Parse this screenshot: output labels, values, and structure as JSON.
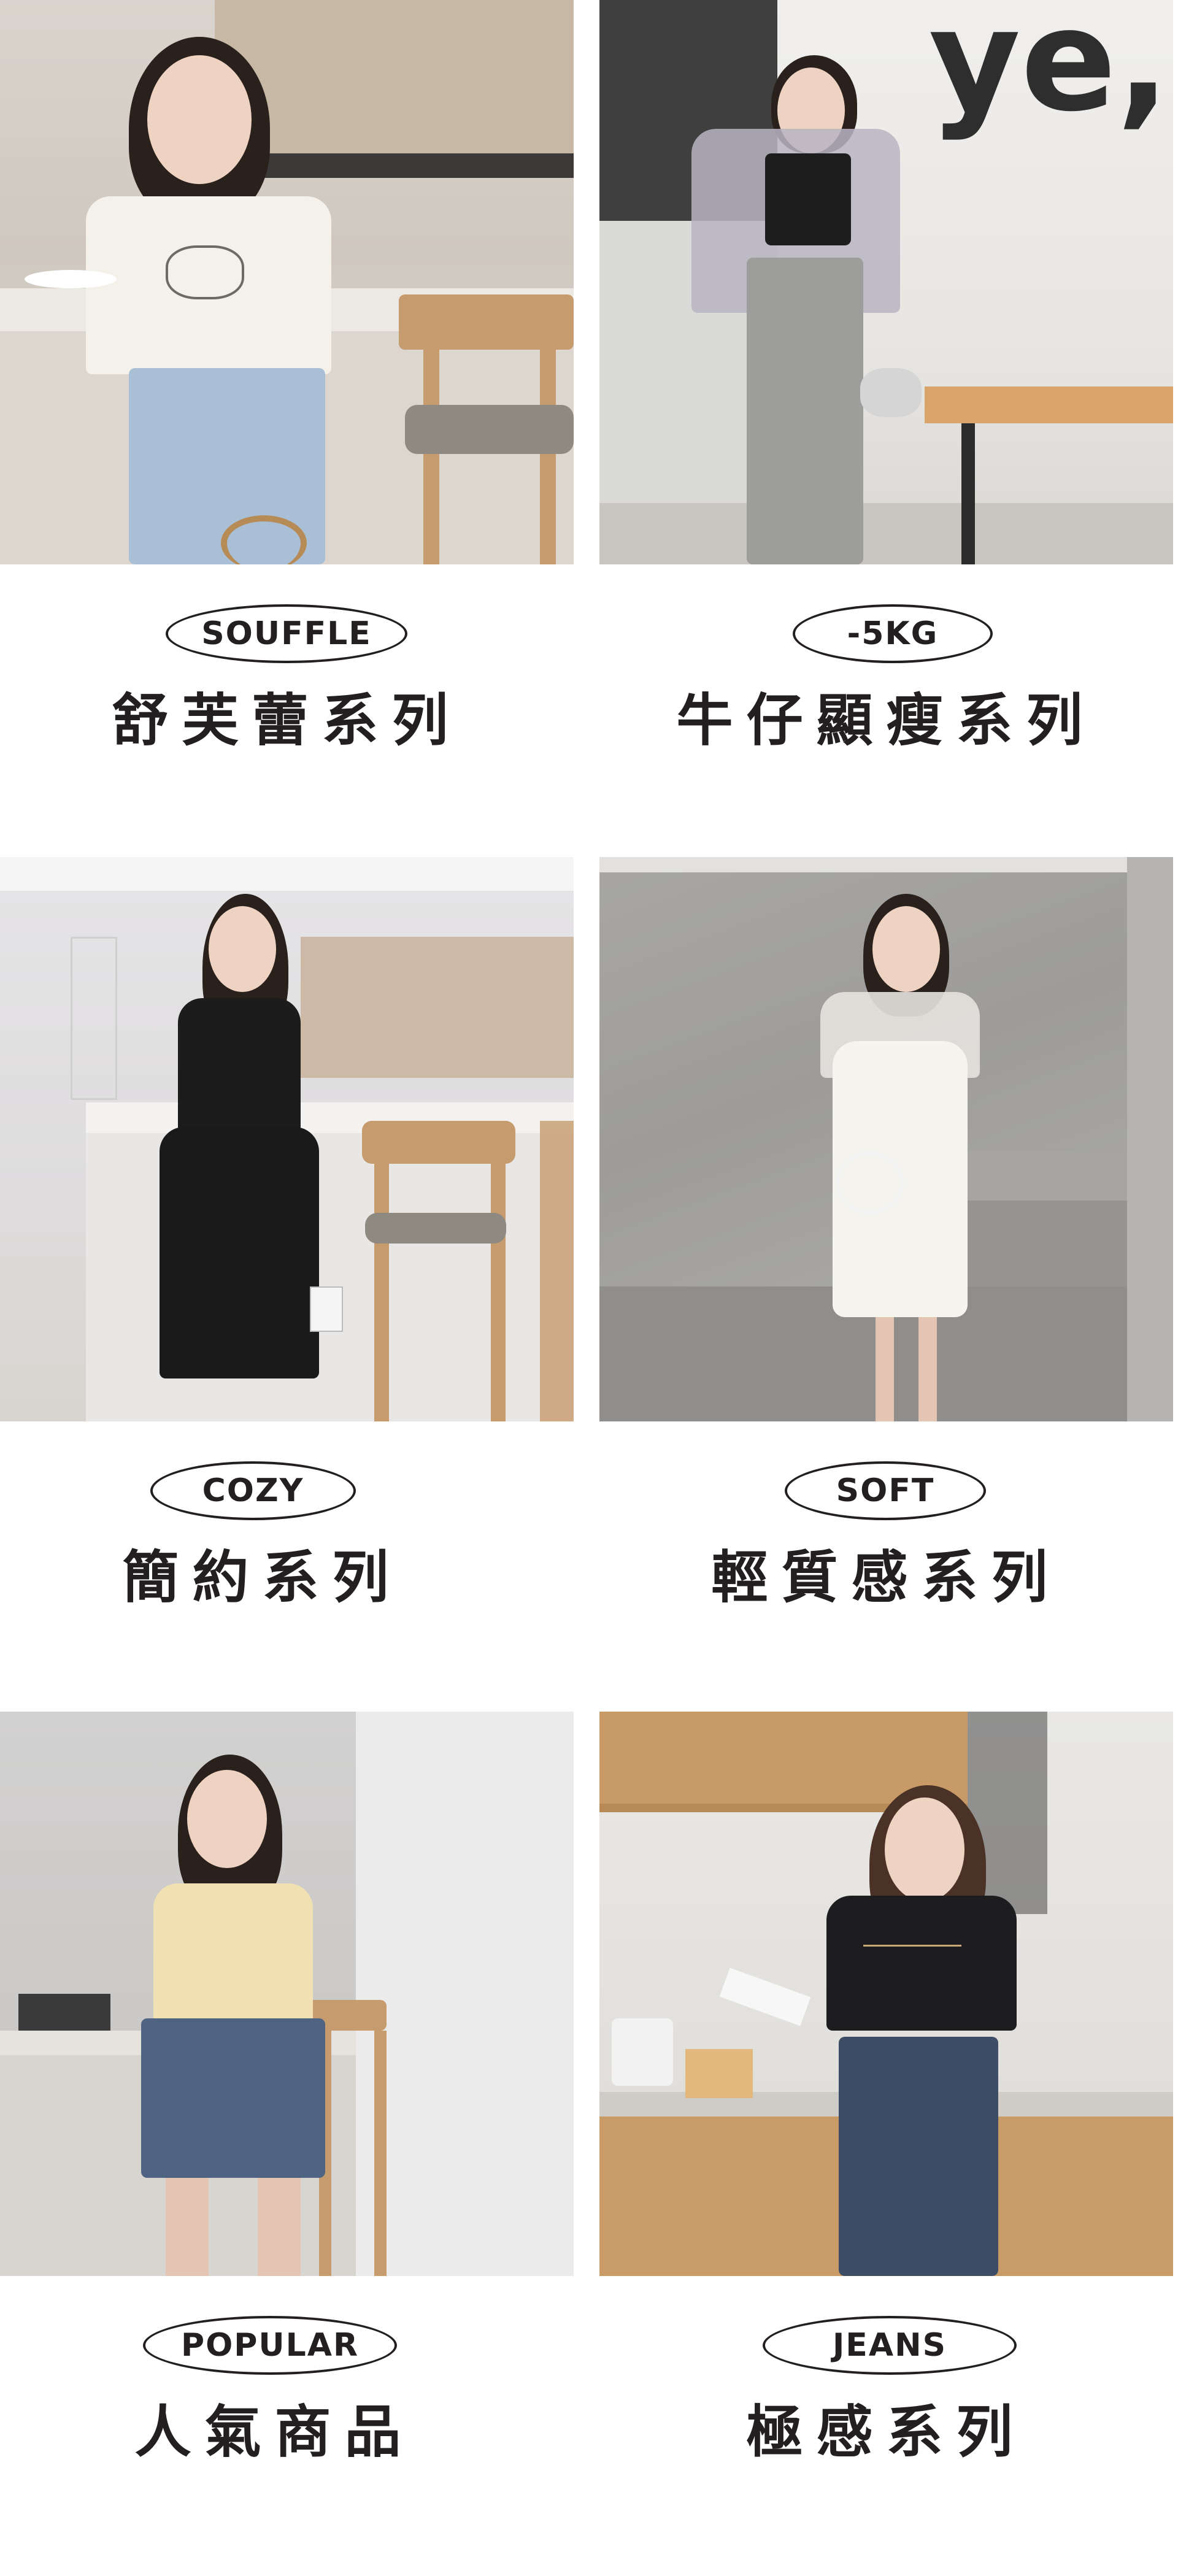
{
  "colors": {
    "text": "#231f20",
    "background": "#ffffff",
    "pill_border": "#231f20"
  },
  "categories": [
    {
      "tag": "SOUFFLE",
      "title": "舒芙蕾系列",
      "photo_desc_icon": "model-photo"
    },
    {
      "tag": "-5KG",
      "title": "牛仔顯瘦系列",
      "photo_desc_icon": "model-photo"
    },
    {
      "tag": "COZY",
      "title": "簡約系列",
      "photo_desc_icon": "model-photo"
    },
    {
      "tag": "SOFT",
      "title": "輕質感系列",
      "photo_desc_icon": "model-photo"
    },
    {
      "tag": "POPULAR",
      "title": "人氣商品",
      "photo_desc_icon": "model-photo"
    },
    {
      "tag": "JEANS",
      "title": "極感系列",
      "photo_desc_icon": "model-photo"
    }
  ],
  "wall_lettering": "ye,"
}
